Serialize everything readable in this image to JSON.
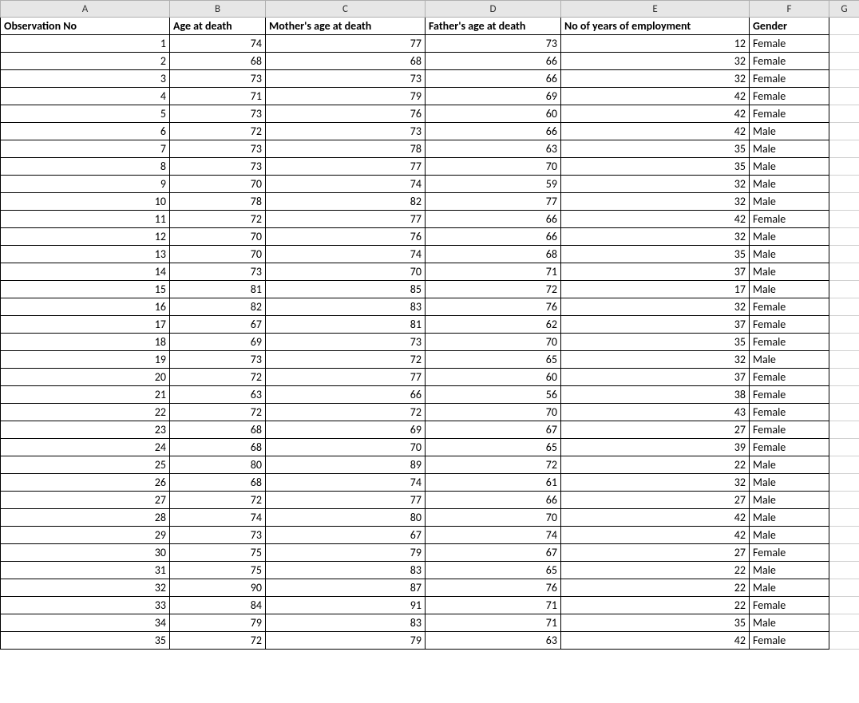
{
  "columns": {
    "letters": [
      "A",
      "B",
      "C",
      "D",
      "E",
      "F",
      "G"
    ],
    "headers": [
      "Observation No",
      "Age at death",
      "Mother's age at death",
      "Father's age at death",
      "No of years of employment",
      "Gender"
    ]
  },
  "rows": [
    {
      "obs": 1,
      "age": 74,
      "mage": 77,
      "fage": 73,
      "emp": 12,
      "gender": "Female"
    },
    {
      "obs": 2,
      "age": 68,
      "mage": 68,
      "fage": 66,
      "emp": 32,
      "gender": "Female"
    },
    {
      "obs": 3,
      "age": 73,
      "mage": 73,
      "fage": 66,
      "emp": 32,
      "gender": "Female"
    },
    {
      "obs": 4,
      "age": 71,
      "mage": 79,
      "fage": 69,
      "emp": 42,
      "gender": "Female"
    },
    {
      "obs": 5,
      "age": 73,
      "mage": 76,
      "fage": 60,
      "emp": 42,
      "gender": "Female"
    },
    {
      "obs": 6,
      "age": 72,
      "mage": 73,
      "fage": 66,
      "emp": 42,
      "gender": "Male"
    },
    {
      "obs": 7,
      "age": 73,
      "mage": 78,
      "fage": 63,
      "emp": 35,
      "gender": "Male"
    },
    {
      "obs": 8,
      "age": 73,
      "mage": 77,
      "fage": 70,
      "emp": 35,
      "gender": "Male"
    },
    {
      "obs": 9,
      "age": 70,
      "mage": 74,
      "fage": 59,
      "emp": 32,
      "gender": "Male"
    },
    {
      "obs": 10,
      "age": 78,
      "mage": 82,
      "fage": 77,
      "emp": 32,
      "gender": "Male"
    },
    {
      "obs": 11,
      "age": 72,
      "mage": 77,
      "fage": 66,
      "emp": 42,
      "gender": "Female"
    },
    {
      "obs": 12,
      "age": 70,
      "mage": 76,
      "fage": 66,
      "emp": 32,
      "gender": "Male"
    },
    {
      "obs": 13,
      "age": 70,
      "mage": 74,
      "fage": 68,
      "emp": 35,
      "gender": "Male"
    },
    {
      "obs": 14,
      "age": 73,
      "mage": 70,
      "fage": 71,
      "emp": 37,
      "gender": "Male"
    },
    {
      "obs": 15,
      "age": 81,
      "mage": 85,
      "fage": 72,
      "emp": 17,
      "gender": "Male"
    },
    {
      "obs": 16,
      "age": 82,
      "mage": 83,
      "fage": 76,
      "emp": 32,
      "gender": "Female"
    },
    {
      "obs": 17,
      "age": 67,
      "mage": 81,
      "fage": 62,
      "emp": 37,
      "gender": "Female"
    },
    {
      "obs": 18,
      "age": 69,
      "mage": 73,
      "fage": 70,
      "emp": 35,
      "gender": "Female"
    },
    {
      "obs": 19,
      "age": 73,
      "mage": 72,
      "fage": 65,
      "emp": 32,
      "gender": "Male"
    },
    {
      "obs": 20,
      "age": 72,
      "mage": 77,
      "fage": 60,
      "emp": 37,
      "gender": "Female"
    },
    {
      "obs": 21,
      "age": 63,
      "mage": 66,
      "fage": 56,
      "emp": 38,
      "gender": "Female"
    },
    {
      "obs": 22,
      "age": 72,
      "mage": 72,
      "fage": 70,
      "emp": 43,
      "gender": "Female"
    },
    {
      "obs": 23,
      "age": 68,
      "mage": 69,
      "fage": 67,
      "emp": 27,
      "gender": "Female"
    },
    {
      "obs": 24,
      "age": 68,
      "mage": 70,
      "fage": 65,
      "emp": 39,
      "gender": "Female"
    },
    {
      "obs": 25,
      "age": 80,
      "mage": 89,
      "fage": 72,
      "emp": 22,
      "gender": "Male"
    },
    {
      "obs": 26,
      "age": 68,
      "mage": 74,
      "fage": 61,
      "emp": 32,
      "gender": "Male"
    },
    {
      "obs": 27,
      "age": 72,
      "mage": 77,
      "fage": 66,
      "emp": 27,
      "gender": "Male"
    },
    {
      "obs": 28,
      "age": 74,
      "mage": 80,
      "fage": 70,
      "emp": 42,
      "gender": "Male"
    },
    {
      "obs": 29,
      "age": 73,
      "mage": 67,
      "fage": 74,
      "emp": 42,
      "gender": "Male"
    },
    {
      "obs": 30,
      "age": 75,
      "mage": 79,
      "fage": 67,
      "emp": 27,
      "gender": "Female"
    },
    {
      "obs": 31,
      "age": 75,
      "mage": 83,
      "fage": 65,
      "emp": 22,
      "gender": "Male"
    },
    {
      "obs": 32,
      "age": 90,
      "mage": 87,
      "fage": 76,
      "emp": 22,
      "gender": "Male"
    },
    {
      "obs": 33,
      "age": 84,
      "mage": 91,
      "fage": 71,
      "emp": 22,
      "gender": "Female"
    },
    {
      "obs": 34,
      "age": 79,
      "mage": 83,
      "fage": 71,
      "emp": 35,
      "gender": "Male"
    },
    {
      "obs": 35,
      "age": 72,
      "mage": 79,
      "fage": 63,
      "emp": 42,
      "gender": "Female"
    }
  ]
}
